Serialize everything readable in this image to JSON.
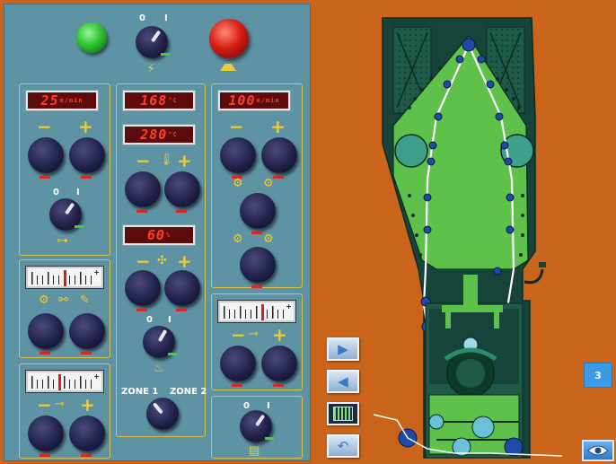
{
  "panel": {
    "top": {
      "green_light": "green-indicator-lamp",
      "red_button": "emergency-stop-button",
      "main_switch": {
        "off_label": "0",
        "on_label": "I",
        "icon": "lightning-icon"
      },
      "stop_icon": "stop-plate-icon"
    },
    "left_col": {
      "display_speed": {
        "value": "25",
        "unit": "m/min"
      },
      "minus": "−",
      "plus": "+",
      "switch": {
        "off_label": "0",
        "on_label": "I",
        "icon": "motor-icon"
      }
    },
    "gauge_block_1": {
      "icons": [
        "gear-icon",
        "tension-icon",
        "wrench-icon"
      ],
      "pm": "+"
    },
    "gauge_block_2": {
      "minus": "−",
      "plus": "+",
      "pm": "+",
      "icon": "roller-icon"
    },
    "mid_col": {
      "display_temp_1": {
        "value": "168",
        "unit": "°C"
      },
      "display_temp_2": {
        "value": "280",
        "unit": "°C"
      },
      "minus": "−",
      "plus": "+",
      "temp_icon": "thermometer-icon",
      "display_percent": {
        "value": "60",
        "unit": "%"
      },
      "fan_icon": "fan-icon",
      "switch": {
        "off_label": "0",
        "on_label": "I",
        "icon": "heater-icon"
      },
      "zone1": "ZONE 1",
      "zone2": "ZONE 2"
    },
    "right_col": {
      "display_value": {
        "value": "100",
        "unit": "m/min"
      },
      "minus": "−",
      "plus": "+",
      "icons": [
        "winder-left-icon",
        "winder-right-icon",
        "winder-up-left-icon",
        "winder-up-right-icon"
      ]
    },
    "gauge_block_3": {
      "minus": "−",
      "plus": "+",
      "pm": "+",
      "icon": "tension-roller-icon"
    },
    "bottom_right": {
      "off_label": "0",
      "on_label": "I",
      "icon": "stack-icon"
    }
  },
  "machine": {
    "page_number": "3",
    "nav": {
      "forward": "▶",
      "back": "◀",
      "overview": "overview-icon",
      "undo": "↶"
    },
    "eye": "eye-icon"
  }
}
